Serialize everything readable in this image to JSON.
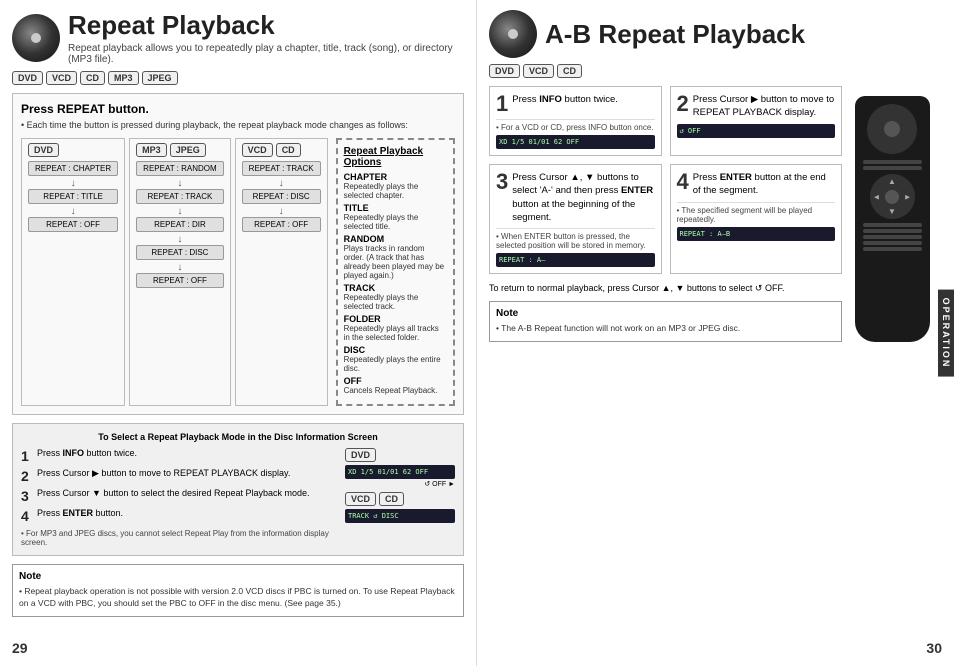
{
  "leftPage": {
    "title": "Repeat Playback",
    "subtitle": "Repeat playback allows you to repeatedly play a chapter, title, track (song), or directory (MP3 file).",
    "formats": [
      "DVD",
      "VCD",
      "CD",
      "MP3",
      "JPEG"
    ],
    "mainBox": {
      "title": "Press REPEAT button.",
      "subtitle": "• Each time the button is pressed during playback, the repeat playback mode changes as follows:"
    },
    "dvdDiagram": {
      "label": "DVD",
      "items": [
        "REPEAT : CHAPTER",
        "↓",
        "REPEAT : TITLE",
        "↓",
        "REPEAT : OFF"
      ]
    },
    "mp3jpegDiagram": {
      "label1": "MP3",
      "label2": "JPEG",
      "items": [
        "REPEAT : RANDOM",
        "↓",
        "REPEAT : TRACK",
        "↓",
        "REPEAT : DIR",
        "↓",
        "REPEAT : DISC",
        "↓",
        "REPEAT : OFF"
      ]
    },
    "vcdcdDiagram": {
      "label1": "VCD",
      "label2": "CD",
      "items": [
        "REPEAT : TRACK",
        "↓",
        "REPEAT : DISC",
        "↓",
        "REPEAT : OFF"
      ]
    },
    "repeatOptions": {
      "title": "Repeat Playback Options",
      "items": [
        {
          "label": "CHAPTER",
          "desc": "Repeatedly plays the selected chapter."
        },
        {
          "label": "TITLE",
          "desc": "Repeatedly plays the selected title."
        },
        {
          "label": "RANDOM",
          "desc": "Plays tracks in random order. (A track that has already been played may be played again.)"
        },
        {
          "label": "TRACK",
          "desc": "Repeatedly plays the selected track."
        },
        {
          "label": "FOLDER",
          "desc": "Repeatedly plays all tracks in the selected folder."
        },
        {
          "label": "DISC",
          "desc": "Repeatedly plays the entire disc."
        },
        {
          "label": "OFF",
          "desc": "Cancels Repeat Playback."
        }
      ]
    },
    "infoScreen": {
      "title": "To Select a Repeat Playback Mode in the Disc Information Screen",
      "badge": "DVD",
      "steps": [
        {
          "num": "1",
          "text": "Press INFO button twice."
        },
        {
          "num": "2",
          "text": "Press Cursor ▶ button to move to REPEAT PLAYBACK display."
        },
        {
          "num": "3",
          "text": "Press Cursor ▼ button to select the desired Repeat Playback mode."
        },
        {
          "num": "4",
          "text": "Press ENTER button."
        }
      ],
      "note": "• For MP3 and JPEG discs, you cannot select Repeat Play from the information display screen."
    },
    "note": {
      "title": "Note",
      "items": [
        "• Repeat playback operation is not possible with version 2.0 VCD discs if PBC is turned on. To use Repeat Playback on a VCD with PBC, you should set the PBC to OFF in the disc menu. (See page 35.)"
      ]
    },
    "pageNumber": "29"
  },
  "rightPage": {
    "title": "A-B Repeat Playback",
    "formats": [
      "DVD",
      "VCD",
      "CD"
    ],
    "steps": [
      {
        "num": "1",
        "title": "Press INFO button twice.",
        "note": "• For a VCD or CD, press INFO button once.",
        "display": "XD 1/5    01/01   62    OFF"
      },
      {
        "num": "2",
        "title": "Press Cursor ▶ button to move to REPEAT PLAYBACK display.",
        "display": "OFF"
      },
      {
        "num": "3",
        "title": "Press Cursor ▲, ▼ buttons to select 'A-' and then press ENTER button at the beginning of the segment.",
        "note": "• When ENTER button is pressed, the selected position will be stored in memory.",
        "display": "REPEAT : A—"
      },
      {
        "num": "4",
        "title": "Press ENTER button at the end of the segment.",
        "note": "• The specified segment will be played repeatedly.",
        "display": "REPEAT : A—B"
      }
    ],
    "returnNote": "To return to normal playback, press Cursor ▲, ▼ buttons to select  ↺ OFF.",
    "note": {
      "title": "Note",
      "text": "• The A-B Repeat function will not work on an MP3 or JPEG disc."
    },
    "pageNumber": "30",
    "operationLabel": "OPERATION"
  }
}
